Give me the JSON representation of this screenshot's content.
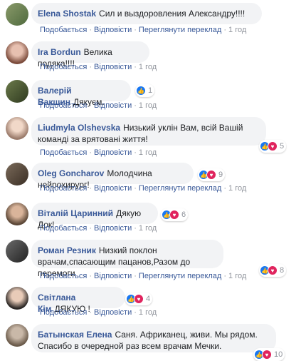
{
  "actions": {
    "like": "Подобається",
    "reply": "Відповісти",
    "translate": "Переглянути переклад",
    "time": "1 год"
  },
  "comments": [
    {
      "author": "Elena Shostak",
      "text": "Сил и выздоровления Александру!!!!"
    },
    {
      "author": "Ira Bordun",
      "text": "Велика подяка!!!!"
    },
    {
      "author": "Валерій Вакшин",
      "text": "Дякуєм.",
      "reactions": "1"
    },
    {
      "author": "Liudmyla Olshevska",
      "text": "Низький уклін Вам, всій Вашій команді за врятовані життя!",
      "reactions": "5"
    },
    {
      "author": "Oleg Goncharov",
      "text": "Молодчина нейрохирург!",
      "reactions": "9"
    },
    {
      "author": "Віталій Царинний",
      "text": "Дякую Док!",
      "reactions": "6"
    },
    {
      "author": "Роман Резник",
      "text": "Низкий поклон врачам,спасающим пацанов,Разом до перемоги",
      "reactions": "8"
    },
    {
      "author": "Світлана Кім",
      "text": "ДЯКУЮ !",
      "reactions": "4"
    },
    {
      "author": "Батынская Елена",
      "text": "Саня. Африканец, живи. Мы рядом. Спасибо в очередной раз всем врачам Мечки.",
      "reactions": "10"
    }
  ],
  "colors": {
    "link": "#385898",
    "bubble": "#f2f3f5",
    "like": "#1877f2",
    "love": "#e0245e"
  },
  "icons": {
    "like": "like-icon",
    "love": "love-icon"
  }
}
